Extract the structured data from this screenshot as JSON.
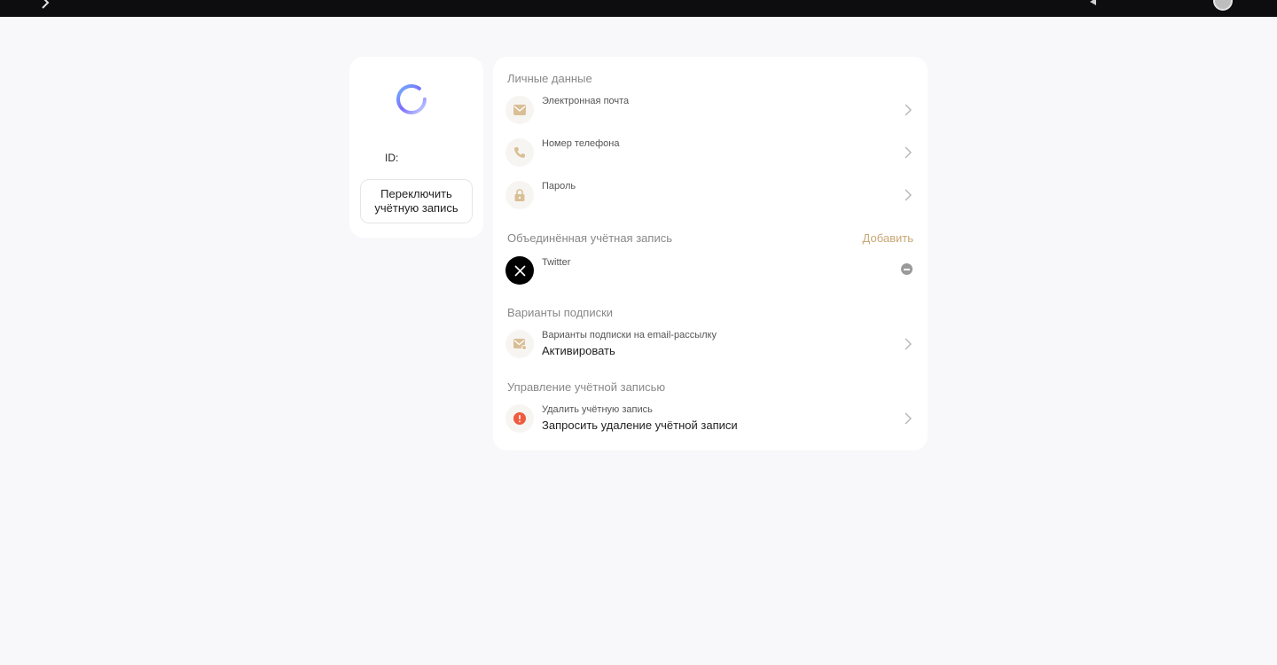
{
  "colors": {
    "accent": "#c9a877",
    "danger": "#ef5b3f",
    "topbar": "#0d0d0f",
    "background": "#f8f8fa"
  },
  "topbar": {
    "icons": [
      "back-icon",
      "bell-icon",
      "avatar"
    ]
  },
  "profile": {
    "avatar_icon": "loader-icon",
    "id_label": "ID:",
    "switch_button": "Переключить учётную запись"
  },
  "personal": {
    "title": "Личные данные",
    "items": [
      {
        "icon": "mail-icon",
        "label": "Электронная почта"
      },
      {
        "icon": "phone-icon",
        "label": "Номер телефона"
      },
      {
        "icon": "lock-icon",
        "label": "Пароль"
      }
    ]
  },
  "linked": {
    "title": "Объединённая учётная запись",
    "add_label": "Добавить",
    "items": [
      {
        "icon": "x-twitter-icon",
        "label": "Twitter"
      }
    ]
  },
  "subscription": {
    "title": "Варианты подписки",
    "items": [
      {
        "icon": "mail-subscribe-icon",
        "label": "Варианты подписки на email-рассылку",
        "value": "Активировать"
      }
    ]
  },
  "management": {
    "title": "Управление учётной записью",
    "items": [
      {
        "icon": "alert-icon",
        "label": "Удалить учётную запись",
        "value": "Запросить удаление учётной записи"
      }
    ]
  }
}
